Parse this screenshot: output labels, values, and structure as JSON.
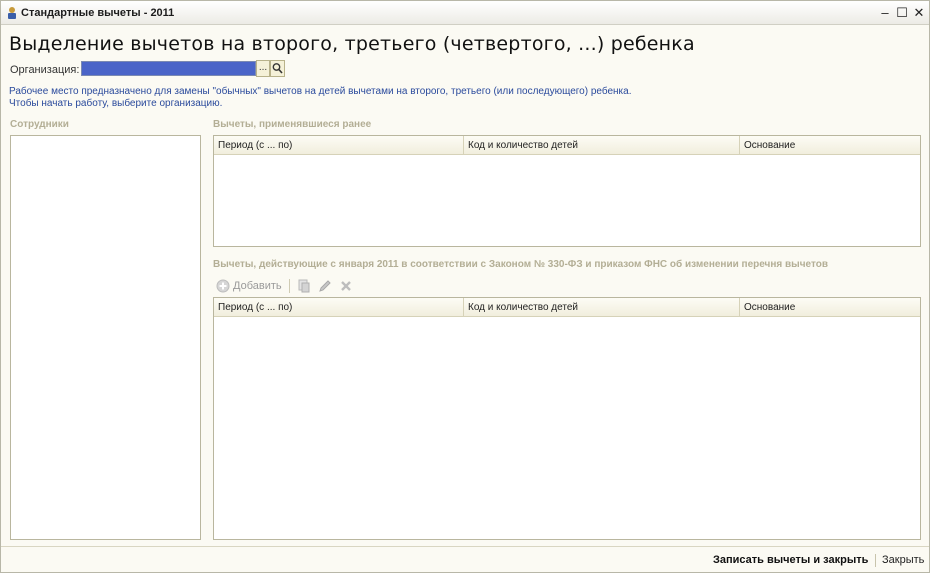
{
  "window": {
    "title": "Стандартные вычеты - 2011",
    "controls": {
      "minimize": "–",
      "maximize": "☐",
      "close": "✕"
    }
  },
  "header": {
    "title": "Выделение вычетов на второго, третьего (четвертого, ...) ребенка"
  },
  "organization": {
    "label": "Организация:",
    "value": "",
    "select_button": "...",
    "search_icon": "search-icon"
  },
  "hint": {
    "line1": "Рабочее место предназначено для замены \"обычных\" вычетов на детей вычетами на второго, третьего (или последующего) ребенка.",
    "line2": "Чтобы начать работу, выберите организацию."
  },
  "employees": {
    "label": "Сотрудники",
    "items": []
  },
  "previous_deductions": {
    "label": "Вычеты, применявшиеся ранее",
    "columns": [
      "Период (с ... по)",
      "Код и количество детей",
      "Основание"
    ],
    "rows": []
  },
  "new_deductions": {
    "label": "Вычеты, действующие с января 2011 в соответствии с Законом № 330-ФЗ и приказом ФНС об изменении перечня вычетов",
    "toolbar": {
      "add_label": "Добавить",
      "icons": [
        "add-icon",
        "copy-icon",
        "edit-icon",
        "delete-icon"
      ]
    },
    "columns": [
      "Период (с ... по)",
      "Код и количество детей",
      "Основание"
    ],
    "rows": []
  },
  "footer": {
    "save_close_label": "Записать вычеты и закрыть",
    "close_label": "Закрыть"
  },
  "colors": {
    "window_bg": "#fbfaf3",
    "section_label": "#b3ae95",
    "hint_text": "#2a4a9c",
    "org_field_fill": "#4a64c8"
  }
}
